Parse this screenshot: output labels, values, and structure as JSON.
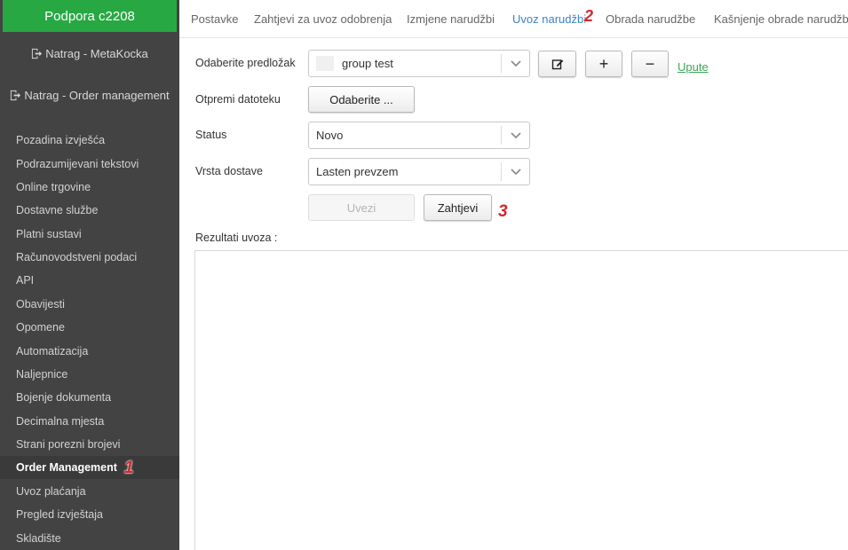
{
  "sidebar": {
    "brand": "Podpora c2208",
    "back_links": [
      "Natrag - MetaKocka",
      "Natrag - Order management"
    ],
    "items": [
      {
        "label": "Pozadina izvješća"
      },
      {
        "label": "Podrazumijevani tekstovi"
      },
      {
        "label": "Online trgovine"
      },
      {
        "label": "Dostavne službe"
      },
      {
        "label": "Platni sustavi"
      },
      {
        "label": "Računovodstveni podaci"
      },
      {
        "label": "API"
      },
      {
        "label": "Obavijesti"
      },
      {
        "label": "Opomene"
      },
      {
        "label": "Automatizacija"
      },
      {
        "label": "Naljepnice"
      },
      {
        "label": "Bojenje dokumenta"
      },
      {
        "label": "Decimalna mjesta"
      },
      {
        "label": "Strani porezni brojevi"
      },
      {
        "label": "Order Management",
        "active": true,
        "marker": "1"
      },
      {
        "label": "Uvoz plaćanja"
      },
      {
        "label": "Pregled izvještaja"
      },
      {
        "label": "Skladište"
      }
    ]
  },
  "tabs": [
    {
      "label": "Postavke"
    },
    {
      "label": "Zahtjevi za uvoz odobrenja"
    },
    {
      "label": "Izmjene narudžbi"
    },
    {
      "label": "Uvoz narudžbi",
      "active": true
    },
    {
      "label": "Obrada narudžbe"
    },
    {
      "label": "Kašnjenje obrade narudžbe"
    }
  ],
  "tab_marker": "2",
  "form": {
    "template_label": "Odaberite predložak",
    "template_value": "group test",
    "file_label": "Otpremi datoteku",
    "file_button": "Odaberite ...",
    "status_label": "Status",
    "status_value": "Novo",
    "delivery_label": "Vrsta dostave",
    "delivery_value": "Lasten prevzem",
    "import_button": "Uvezi",
    "requests_button": "Zahtjevi",
    "requests_marker": "3",
    "help_link": "Upute",
    "plus_label": "+",
    "minus_label": "−",
    "results_label": "Rezultati uvoza :"
  },
  "colors": {
    "brand": "#27a843",
    "sidebar_bg": "#434343",
    "tab_active": "#3b83c8",
    "link": "#3ca85a",
    "marker": "#d0282d"
  }
}
